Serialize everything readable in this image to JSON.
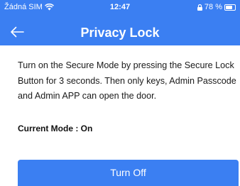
{
  "status_bar": {
    "carrier": "Žádná SIM",
    "time": "12:47",
    "battery": "78 %",
    "battery_level": 0.78
  },
  "nav": {
    "title": "Privacy Lock",
    "back_icon": "back-arrow-icon"
  },
  "content": {
    "description": "Turn on the Secure Mode by pressing the Secure Lock Button for 3 seconds. Then only keys, Admin Passcode and Admin APP can open the door.",
    "current_mode": "Current Mode : On",
    "button_label": "Turn Off"
  },
  "colors": {
    "accent": "#3b7ff2",
    "text": "#1a1a1a"
  }
}
